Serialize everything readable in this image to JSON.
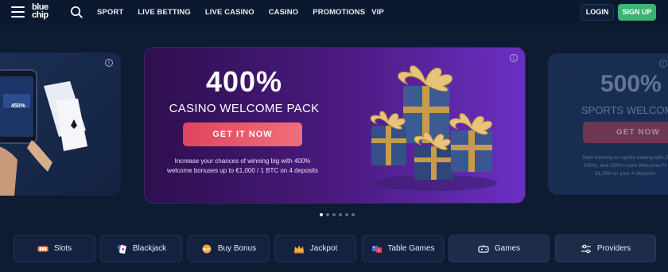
{
  "header": {
    "logo_line1": "blue",
    "logo_line2": "chip",
    "nav": [
      "SPORT",
      "LIVE BETTING",
      "LIVE CASINO",
      "CASINO",
      "PROMOTIONS",
      "VIP"
    ],
    "login_label": "LOGIN",
    "signup_label": "SIGN UP"
  },
  "carousel": {
    "left_card": {
      "phone_text": "450%"
    },
    "center_card": {
      "headline": "400%",
      "subtitle": "CASINO WELCOME PACK",
      "cta": "GET IT NOW",
      "description": "Increase your chances of winning big with 400% welcome bonuses up to €1,000 / 1 BTC on 4 deposits"
    },
    "right_card": {
      "headline": "500%",
      "subtitle": "SPORTS WELCOME",
      "cta": "GET NOW",
      "desc_line1": "Start winning on sports betting with 2",
      "desc_line2": "100%, and 100% more Welcome Fr",
      "desc_line3": "€1,000 on your 4 deposits"
    },
    "dots_count": 6,
    "active_dot": 0
  },
  "categories": [
    {
      "label": "Slots",
      "icon": "slot-machine-icon"
    },
    {
      "label": "Blackjack",
      "icon": "cards-icon"
    },
    {
      "label": "Buy Bonus",
      "icon": "bonus-coin-icon"
    },
    {
      "label": "Jackpot",
      "icon": "crown-icon"
    },
    {
      "label": "Table Games",
      "icon": "dice-icon"
    },
    {
      "label": "Games",
      "icon": "gamepad-icon"
    },
    {
      "label": "Providers",
      "icon": "sliders-icon"
    }
  ],
  "colors": {
    "background": "#0d1b33",
    "signup_green": "#3cb371",
    "cta_pink": "#e0455d",
    "promo_purple": "#6b2fc4"
  }
}
